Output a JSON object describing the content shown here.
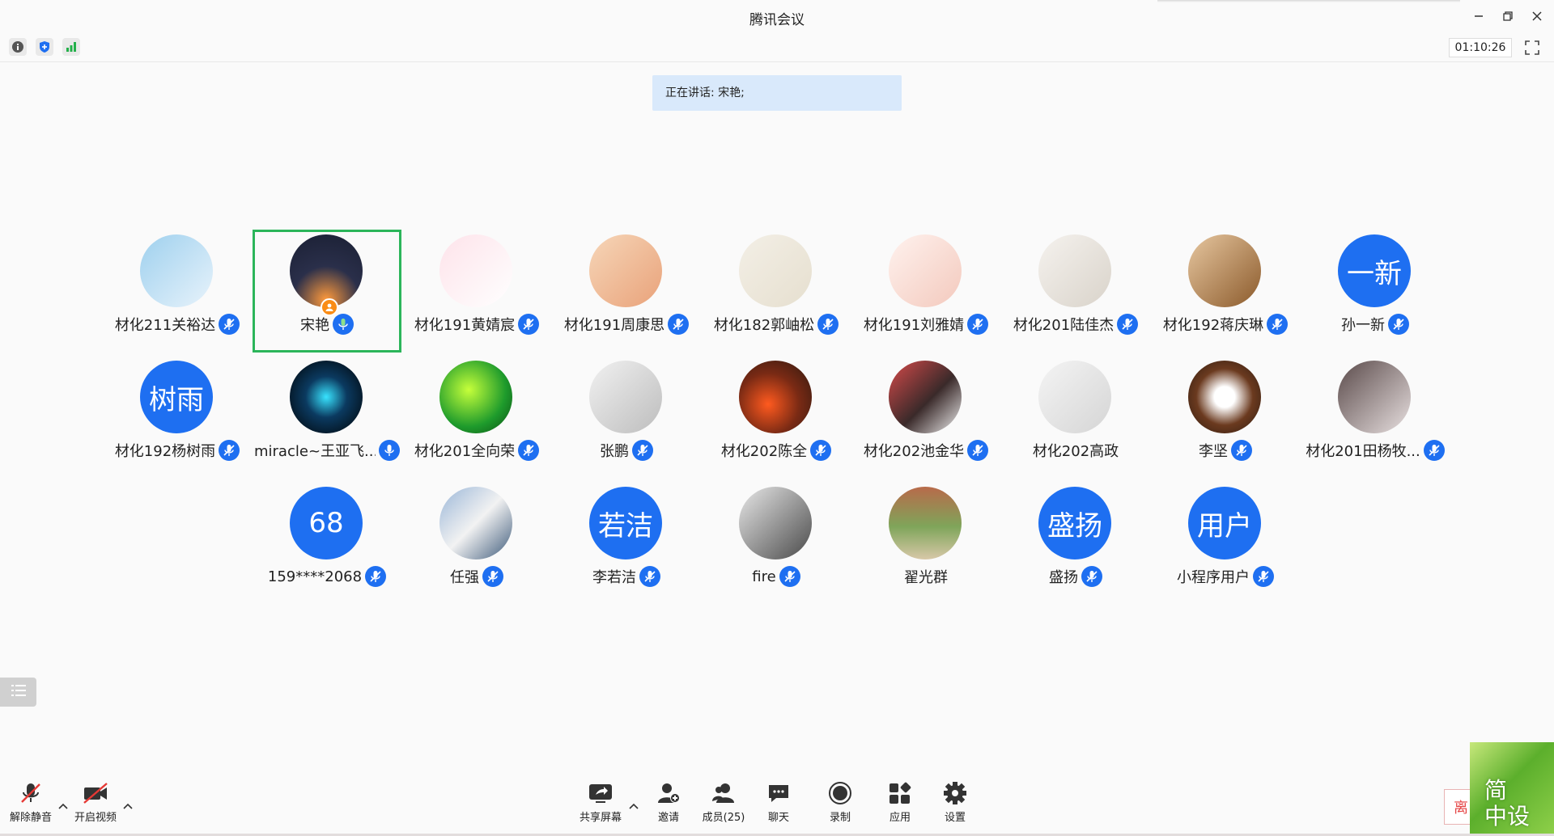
{
  "window": {
    "title": "腾讯会议",
    "controls": [
      "minimize-icon",
      "restore-icon",
      "close-icon"
    ]
  },
  "status_bar": {
    "icons": [
      "info-icon",
      "shield-icon",
      "signal-icon"
    ],
    "timer": "01:10:26"
  },
  "speaking_banner": "正在讲话: 宋艳;",
  "colors": {
    "accent": "#1e6ff1",
    "active_border": "#2bb55a",
    "banner_bg": "#d9e9fb"
  },
  "participants": [
    {
      "name": "材化211关裕达",
      "avatar_type": "image",
      "avatar_desc": "cartoon boy",
      "mic": "muted"
    },
    {
      "name": "宋艳",
      "avatar_type": "image",
      "avatar_desc": "night sky sunset",
      "mic": "speaking",
      "active": true,
      "host": true
    },
    {
      "name": "材化191黄婧宸",
      "avatar_type": "image",
      "avatar_desc": "hello kitty",
      "mic": "muted"
    },
    {
      "name": "材化191周康思",
      "avatar_type": "image",
      "avatar_desc": "cartoon girl",
      "mic": "muted"
    },
    {
      "name": "材化182郭岫松",
      "avatar_type": "image",
      "avatar_desc": "dog sketch",
      "mic": "muted"
    },
    {
      "name": "材化191刘雅婧",
      "avatar_type": "image",
      "avatar_desc": "cartoon glasses girl",
      "mic": "muted"
    },
    {
      "name": "材化201陆佳杰",
      "avatar_type": "image",
      "avatar_desc": "note paper",
      "mic": "muted"
    },
    {
      "name": "材化192蒋庆琳",
      "avatar_type": "image",
      "avatar_desc": "anime girl",
      "mic": "muted"
    },
    {
      "name": "孙一新",
      "avatar_type": "text",
      "avatar_text": "一新",
      "mic": "muted"
    },
    {
      "name": "材化192杨树雨",
      "avatar_type": "text",
      "avatar_text": "树雨",
      "mic": "muted"
    },
    {
      "name": "miracle~王亚飞...",
      "avatar_type": "image",
      "avatar_desc": "glowing flasks",
      "mic": "on"
    },
    {
      "name": "材化201全向荣",
      "avatar_type": "image",
      "avatar_desc": "green stage",
      "mic": "muted"
    },
    {
      "name": "张鹏",
      "avatar_type": "image",
      "avatar_desc": "cat toy",
      "mic": "muted"
    },
    {
      "name": "材化202陈全",
      "avatar_type": "image",
      "avatar_desc": "flowers",
      "mic": "muted"
    },
    {
      "name": "材化202池金华",
      "avatar_type": "image",
      "avatar_desc": "man portrait",
      "mic": "muted"
    },
    {
      "name": "材化202高政",
      "avatar_type": "image",
      "avatar_desc": "white rabbit",
      "mic": "none"
    },
    {
      "name": "李坚",
      "avatar_type": "image",
      "avatar_desc": "white flower",
      "mic": "muted"
    },
    {
      "name": "材化201田杨牧...",
      "avatar_type": "image",
      "avatar_desc": "two people",
      "mic": "muted"
    },
    {
      "name": "159****2068",
      "avatar_type": "text",
      "avatar_text": "68",
      "mic": "muted"
    },
    {
      "name": "任强",
      "avatar_type": "image",
      "avatar_desc": "man at podium",
      "mic": "muted"
    },
    {
      "name": "李若洁",
      "avatar_type": "text",
      "avatar_text": "若洁",
      "mic": "muted"
    },
    {
      "name": "fire",
      "avatar_type": "image",
      "avatar_desc": "bw portrait",
      "mic": "muted"
    },
    {
      "name": "翟光群",
      "avatar_type": "image",
      "avatar_desc": "outdoor photo",
      "mic": "none"
    },
    {
      "name": "盛扬",
      "avatar_type": "text",
      "avatar_text": "盛扬",
      "mic": "muted"
    },
    {
      "name": "小程序用户",
      "avatar_type": "text",
      "avatar_text": "用户",
      "mic": "muted"
    }
  ],
  "toolbar": {
    "unmute": "解除静音",
    "start_video": "开启视频",
    "share_screen": "共享屏幕",
    "invite": "邀请",
    "members": "成员(25)",
    "chat": "聊天",
    "record": "录制",
    "apps": "应用",
    "settings": "设置",
    "leave": "离"
  },
  "overlay_logo": {
    "line1": "简",
    "line2": "中设"
  }
}
